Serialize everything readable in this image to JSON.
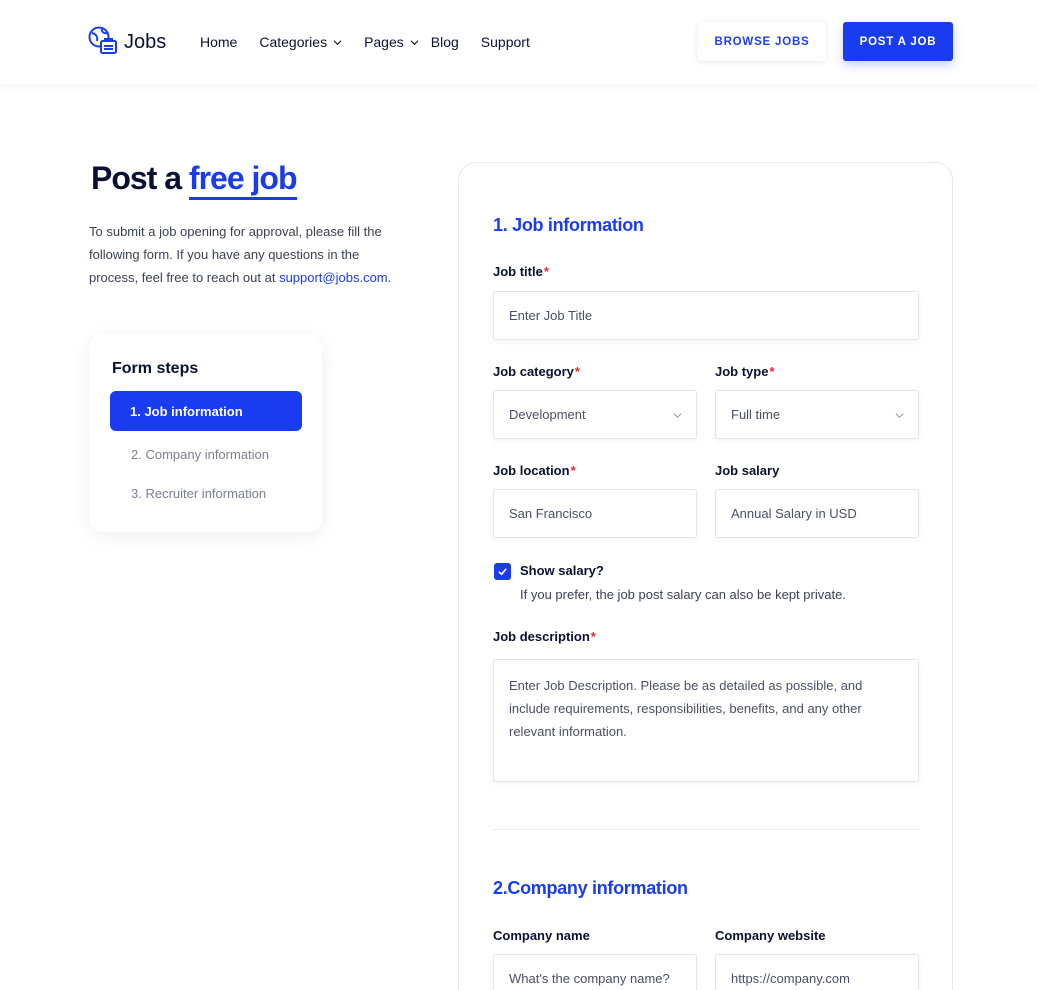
{
  "header": {
    "logo_text": "Jobs",
    "nav": {
      "home": "Home",
      "categories": "Categories",
      "pages": "Pages",
      "blog": "Blog",
      "support": "Support"
    },
    "browse_label": "BROWSE JOBS",
    "post_label": "POST A JOB"
  },
  "intro": {
    "title_prefix": "Post a",
    "title_accent": "free job",
    "text": "To submit a job opening for approval, please fill the following form. If you have any questions in the process, feel free to reach out at",
    "email": "support@jobs.com",
    "text_end": "."
  },
  "steps": {
    "title": "Form steps",
    "items": [
      "1. Job information",
      "2. Company information",
      "3. Recruiter information"
    ]
  },
  "form": {
    "section1_title": "1. Job information",
    "job_title_label": "Job title",
    "job_title_placeholder": "Enter Job Title",
    "category_label": "Job category",
    "category_value": "Development",
    "type_label": "Job type",
    "type_value": "Full time",
    "location_label": "Job location",
    "location_value": "San Francisco",
    "salary_label": "Job salary",
    "salary_placeholder": "Annual Salary in USD",
    "show_salary_label": "Show salary?",
    "show_salary_help": "If you prefer, the job post salary can also be kept private.",
    "description_label": "Job description",
    "description_placeholder": "Enter Job Description. Please be as detailed as possible, and include requirements, responsibilities, benefits, and any other relevant information.",
    "required_mark": "*",
    "section2_title": "2.Company information",
    "company_name_label": "Company name",
    "company_name_placeholder": "What's the company name?",
    "company_website_label": "Company website",
    "company_website_placeholder": "https://company.com"
  },
  "colors": {
    "accent": "#1a3cf0",
    "required": "#e0293a"
  }
}
